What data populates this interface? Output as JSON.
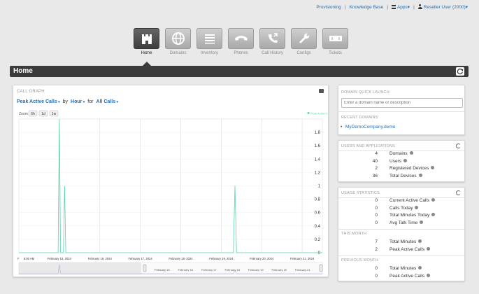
{
  "topnav": {
    "provisioning": "Provisioning",
    "knowledge_base": "Knowledge Base",
    "apps": "Apps",
    "user": "Reseller User (2000)"
  },
  "tiles": [
    {
      "label": "Home",
      "icon": "castle-icon",
      "active": true
    },
    {
      "label": "Domains",
      "icon": "globe-icon",
      "active": false
    },
    {
      "label": "Inventory",
      "icon": "list-icon",
      "active": false
    },
    {
      "label": "Phones",
      "icon": "phone-icon",
      "active": false
    },
    {
      "label": "Call History",
      "icon": "call-history-icon",
      "active": false
    },
    {
      "label": "Configs",
      "icon": "wrench-icon",
      "active": false
    },
    {
      "label": "Tickets",
      "icon": "ticket-icon",
      "active": false
    }
  ],
  "page": {
    "title": "Home"
  },
  "call_graph": {
    "header": "CALL GRAPH",
    "metric": "Peak Active Calls",
    "by_label": "by",
    "interval": "Hour",
    "for_label": "for",
    "scope": "All Calls",
    "zoom_label": "Zoom",
    "zoom_options": [
      "6h",
      "1d",
      "1w"
    ],
    "legend": "Peak Active Calls",
    "colors": {
      "line": "#58d3b4",
      "grid": "#dddddd"
    }
  },
  "chart_data": {
    "type": "line",
    "title": "",
    "xlabel": "",
    "ylabel": "",
    "ylim": [
      0,
      2
    ],
    "yticks": [
      "0",
      "0.2",
      "0.4",
      "0.6",
      "0.8",
      "1",
      "1.2",
      "1.4",
      "1.6",
      "1.8"
    ],
    "xticks": [
      "F",
      "6:00 AM",
      "February 15, 2024",
      "February 16, 2024",
      "February 17, 2024",
      "February 18, 2024",
      "February 19, 2024",
      "February 20, 2024",
      "February 21, 2024"
    ],
    "x_tick_units": [
      0,
      0.25,
      1,
      2,
      3,
      4,
      5,
      6,
      7
    ],
    "navigator_labels": [
      "February 15",
      "February 16",
      "February 17",
      "February 18",
      "February 19",
      "February 20",
      "February 21"
    ],
    "series": [
      {
        "name": "Peak Active Calls",
        "x": [
          0,
          0.97,
          1.0,
          1.03,
          1.1,
          1.13,
          1.16,
          1.19,
          1.22,
          5.3,
          5.34,
          5.38,
          5.42,
          7.5
        ],
        "values": [
          0,
          0,
          2,
          0,
          0,
          1,
          0,
          0,
          0,
          0,
          1,
          0,
          0,
          0
        ]
      }
    ]
  },
  "right": {
    "quick_launch_header": "DOMAIN QUICK LAUNCH",
    "domain_placeholder": "Enter a domain name or description",
    "recent_header": "RECENT DOMAINS",
    "recent_domain": "MyDemoCompany.demo",
    "users_header": "USERS AND APPLICATIONS",
    "users_stats": [
      {
        "value": "4",
        "label": "Domains"
      },
      {
        "value": "40",
        "label": "Users"
      },
      {
        "value": "2",
        "label": "Registered Devices"
      },
      {
        "value": "36",
        "label": "Total Devices"
      }
    ],
    "usage_header": "USAGE STATISTICS",
    "usage_stats": [
      {
        "value": "0",
        "label": "Current Active Calls"
      },
      {
        "value": "0",
        "label": "Calls Today"
      },
      {
        "value": "0",
        "label": "Total Minutes Today"
      },
      {
        "value": "0",
        "label": "Avg Talk Time"
      }
    ],
    "this_month_header": "THIS MONTH",
    "this_month_stats": [
      {
        "value": "7",
        "label": "Total Minutes"
      },
      {
        "value": "2",
        "label": "Peak Active Calls"
      }
    ],
    "prev_month_header": "PREVIOUS MONTH",
    "prev_month_stats": [
      {
        "value": "0",
        "label": "Total Minutes"
      },
      {
        "value": "0",
        "label": "Peak Active Calls"
      }
    ]
  }
}
